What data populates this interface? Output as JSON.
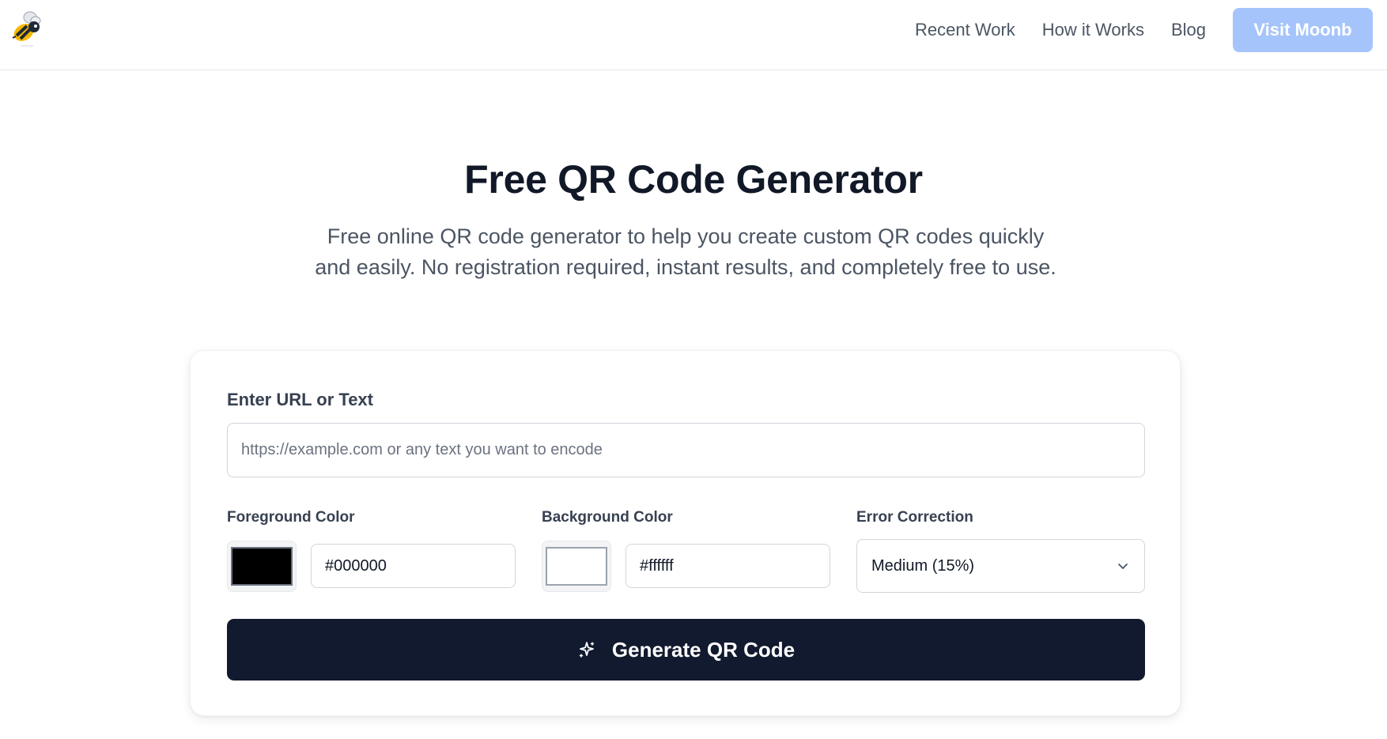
{
  "header": {
    "logo_icon": "bee-logo-icon",
    "nav": [
      {
        "label": "Recent Work"
      },
      {
        "label": "How it Works"
      },
      {
        "label": "Blog"
      }
    ],
    "cta_label": "Visit Moonb",
    "cta_color": "#a5c4fb"
  },
  "hero": {
    "title": "Free QR Code Generator",
    "subtitle": "Free online QR code generator to help you create custom QR codes quickly and easily. No registration required, instant results, and completely free to use."
  },
  "form": {
    "url_label": "Enter URL or Text",
    "url_placeholder": "https://example.com or any text you want to encode",
    "url_value": "",
    "foreground": {
      "label": "Foreground Color",
      "value": "#000000"
    },
    "background": {
      "label": "Background Color",
      "value": "#ffffff"
    },
    "error_correction": {
      "label": "Error Correction",
      "selected": "Medium (15%)",
      "icon": "chevron-down-icon"
    },
    "generate_label": "Generate QR Code",
    "generate_icon": "sparkles-icon",
    "generate_color": "#111a2e"
  }
}
